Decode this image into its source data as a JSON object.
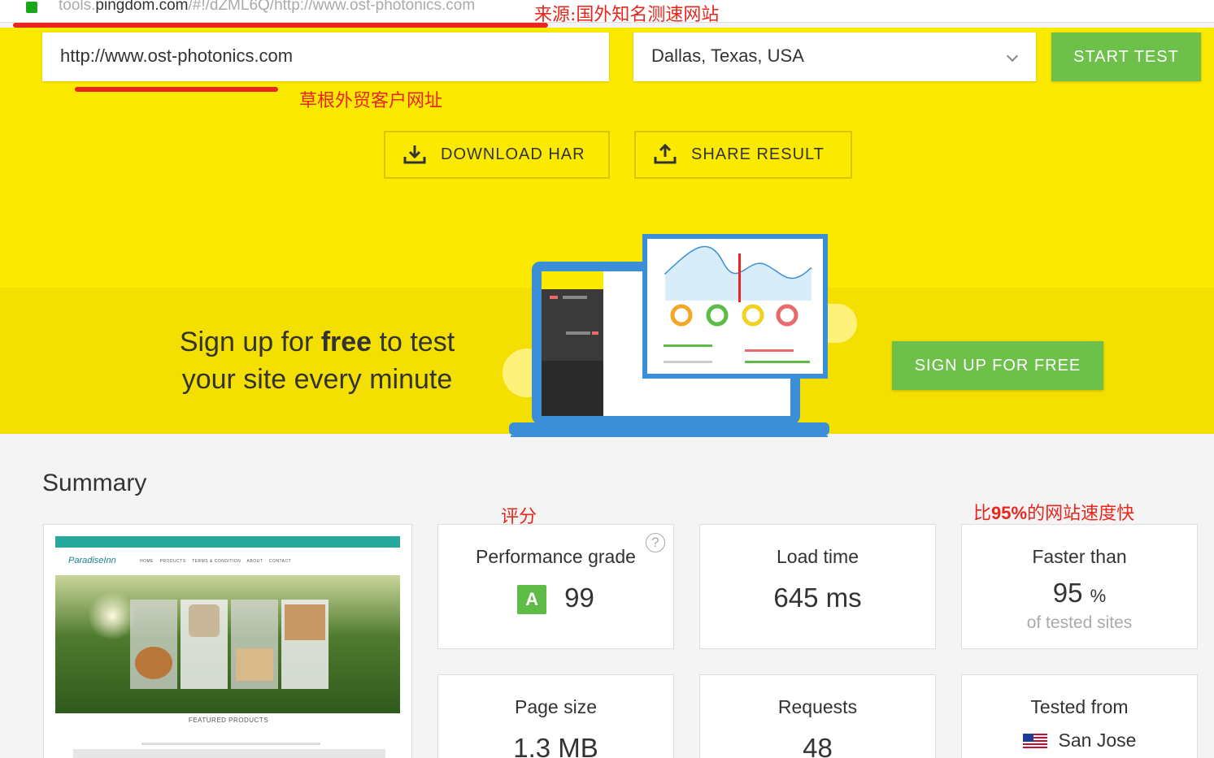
{
  "browser": {
    "url_prefix": "tools.",
    "url_domain": "pingdom.com",
    "url_rest": "/#!/dZML6Q/http://www.ost-photonics.com",
    "annotation": "来源:国外知名测速网站"
  },
  "form": {
    "url_value": "http://www.ost-photonics.com",
    "url_annotation": "草根外贸客户网址",
    "location": "Dallas, Texas, USA",
    "start_label": "START TEST"
  },
  "actions": {
    "download_label": "DOWNLOAD HAR",
    "share_label": "SHARE RESULT"
  },
  "promo": {
    "line1_a": "Sign up for ",
    "line1_b": "free",
    "line1_c": " to test",
    "line2": "your site every minute",
    "signup_label": "SIGN UP FOR FREE"
  },
  "summary": {
    "title": "Summary",
    "grade_annotation": "评分",
    "faster_annotation_a": "比",
    "faster_annotation_b": "95%",
    "faster_annotation_c": "的网站速度快",
    "performance_label": "Performance grade",
    "grade_letter": "A",
    "grade_value": "99",
    "help": "?",
    "load_label": "Load time",
    "load_value": "645 ms",
    "faster_label": "Faster than",
    "faster_value": "95",
    "faster_unit": "%",
    "faster_sub": "of tested sites",
    "size_label": "Page size",
    "size_value": "1.3 MB",
    "requests_label": "Requests",
    "requests_value": "48",
    "tested_label": "Tested from",
    "tested_value": "San Jose"
  },
  "screenshot_preview": {
    "logo": "ParadiseInn",
    "nav": [
      "HOME",
      "PRODUCTS",
      "TERMS & CONDITION",
      "ABOUT",
      "CONTACT"
    ],
    "section": "FEATURED PRODUCTS"
  },
  "colors": {
    "accent_green": "#6dc04a",
    "hero_yellow": "#fbe900",
    "annotation_red": "#e8261d"
  }
}
